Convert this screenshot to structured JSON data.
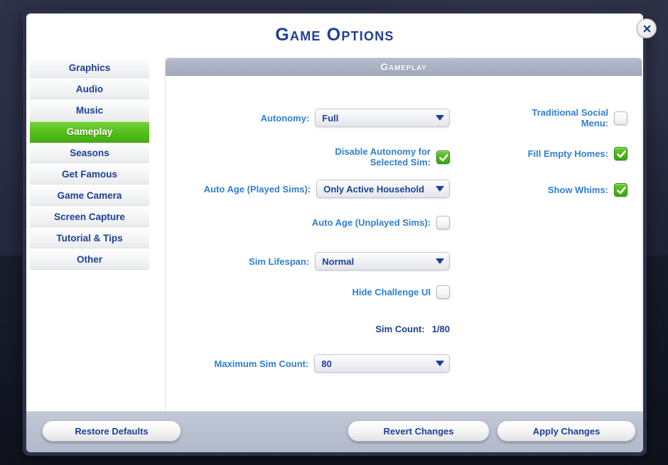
{
  "dialog": {
    "title": "Game Options",
    "close_icon": "close-x-icon"
  },
  "sidebar": {
    "items": [
      {
        "label": "Graphics",
        "active": false
      },
      {
        "label": "Audio",
        "active": false
      },
      {
        "label": "Music",
        "active": false
      },
      {
        "label": "Gameplay",
        "active": true
      },
      {
        "label": "Seasons",
        "active": false
      },
      {
        "label": "Get Famous",
        "active": false
      },
      {
        "label": "Game Camera",
        "active": false
      },
      {
        "label": "Screen Capture",
        "active": false
      },
      {
        "label": "Tutorial & Tips",
        "active": false
      },
      {
        "label": "Other",
        "active": false
      }
    ]
  },
  "content": {
    "section_header": "Gameplay",
    "left_column": {
      "autonomy": {
        "label": "Autonomy:",
        "value": "Full",
        "arrow_icon": "chevron-down-icon"
      },
      "disable_autonomy_selected_sim": {
        "label_line1": "Disable Autonomy for",
        "label_line2": "Selected Sim:",
        "checked": true
      },
      "auto_age_played": {
        "label": "Auto Age (Played Sims):",
        "value": "Only Active Household",
        "arrow_icon": "chevron-down-icon"
      },
      "auto_age_unplayed": {
        "label": "Auto Age (Unplayed Sims):",
        "checked": false
      },
      "sim_lifespan": {
        "label": "Sim Lifespan:",
        "value": "Normal",
        "arrow_icon": "chevron-down-icon"
      },
      "hide_challenge_ui": {
        "label": "Hide Challenge UI",
        "checked": false
      },
      "sim_count": {
        "label": "Sim Count:",
        "value": "1/80"
      },
      "maximum_sim_count": {
        "label": "Maximum Sim Count:",
        "value": "80",
        "arrow_icon": "chevron-down-icon"
      }
    },
    "right_column": {
      "traditional_social_menu": {
        "label_line1": "Traditional Social",
        "label_line2": "Menu:",
        "checked": false
      },
      "fill_empty_homes": {
        "label": "Fill Empty Homes:",
        "checked": true
      },
      "show_whims": {
        "label": "Show Whims:",
        "checked": true
      }
    }
  },
  "footer": {
    "restore_defaults": "Restore Defaults",
    "revert_changes": "Revert Changes",
    "apply_changes": "Apply Changes"
  },
  "colors": {
    "accent_blue": "#1c4096",
    "label_blue": "#2f7fd4",
    "active_green": "#56be1c",
    "checkbox_green": "#4eb61a",
    "header_gray": "#a9b1c2"
  }
}
